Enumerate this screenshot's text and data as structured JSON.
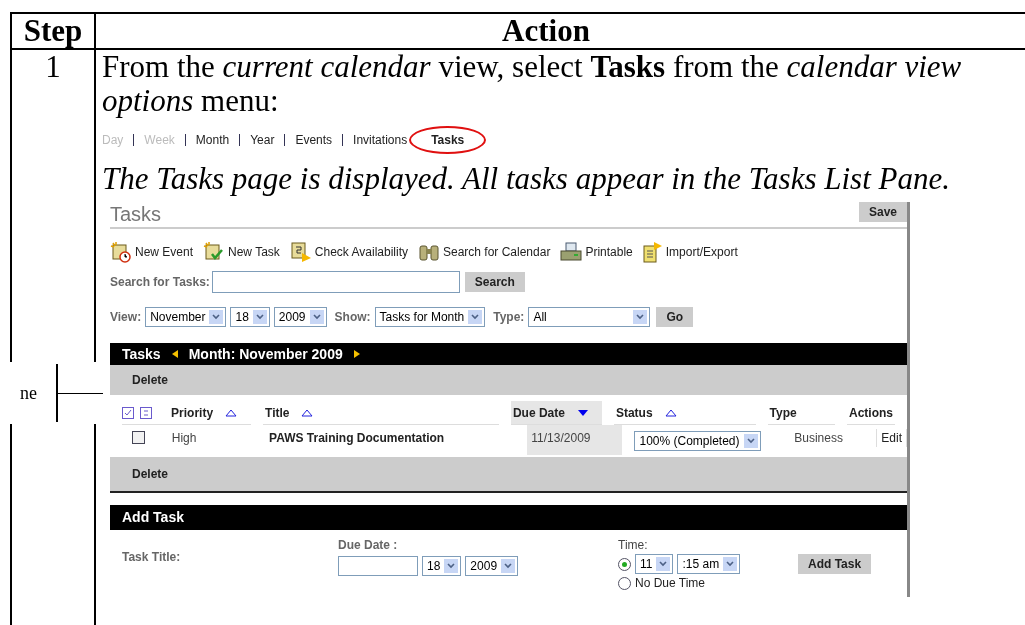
{
  "table": {
    "columns": [
      "Step",
      "Action"
    ],
    "rows": [
      {
        "step": "1",
        "instruction": "From the *current calendar* view, select **Tasks** from the *calendar view options* menu:",
        "menu": [
          {
            "label": "Day",
            "disabled": true,
            "selected": false
          },
          {
            "label": "Week",
            "disabled": true,
            "selected": false
          },
          {
            "label": "Month",
            "disabled": false,
            "selected": false
          },
          {
            "label": "Year",
            "disabled": false,
            "selected": false
          },
          {
            "label": "Events",
            "disabled": false,
            "selected": false
          },
          {
            "label": "Invitations",
            "disabled": false,
            "selected": false
          },
          {
            "label": "Tasks",
            "disabled": false,
            "selected": true
          }
        ],
        "result": "The Tasks page is displayed. All tasks appear in the Tasks List Pane.",
        "screenshot": {
          "title": "Tasks",
          "save_button": "Save",
          "toolbar": [
            {
              "kind": "event",
              "label": "New Event"
            },
            {
              "kind": "task",
              "label": "New Task"
            },
            {
              "kind": "availability",
              "label": "Check Availability"
            },
            {
              "kind": "binoculars",
              "label": "Search for Calendar"
            },
            {
              "kind": "printer",
              "label": "Printable"
            },
            {
              "kind": "export",
              "label": "Import/Export"
            }
          ],
          "search": {
            "label": "Search for Tasks:",
            "button": "Search"
          },
          "filters": [
            {
              "label": "View:",
              "selects": [
                "November",
                "18",
                "2009"
              ]
            },
            {
              "label": "Show:",
              "selects": [
                "Tasks for Month"
              ]
            },
            {
              "label": "Type:",
              "selects": [
                "All"
              ]
            }
          ],
          "go_button": "Go",
          "list_pane": {
            "title": "Tasks",
            "period": "Month: November 2009",
            "delete_button_top": "Delete",
            "delete_button_bottom": "Delete",
            "columns": [
              {
                "label": "Priority",
                "sortable": true,
                "descending": false,
                "selected": false
              },
              {
                "label": "Title",
                "sortable": true,
                "descending": false,
                "selected": false
              },
              {
                "label": "Due Date",
                "sortable": true,
                "descending": true,
                "selected": true
              },
              {
                "label": "Status",
                "sortable": true,
                "descending": false,
                "selected": false
              },
              {
                "label": "Type",
                "sortable": false,
                "selected": false
              },
              {
                "label": "Actions",
                "sortable": false,
                "selected": false
              }
            ],
            "rows": [
              {
                "checked": false,
                "priority": "High",
                "title": "PAWS Training Documentation",
                "due_date": "11/13/2009",
                "status": "100% (Completed)",
                "type": "Business",
                "action": "Edit"
              }
            ]
          },
          "add_task": {
            "title": "Add Task",
            "task_title_label": "Task Title:",
            "due_date_label": "Due Date :",
            "due_date_selects": [
              "18",
              "2009"
            ],
            "time_label": "Time:",
            "time_options": [
              {
                "selected": true,
                "selects": [
                  "11",
                  ":15 am"
                ]
              },
              {
                "selected": false,
                "label": "No Due Time"
              }
            ],
            "button": "Add Task"
          }
        }
      }
    ]
  },
  "callout": {
    "label": "ne"
  }
}
